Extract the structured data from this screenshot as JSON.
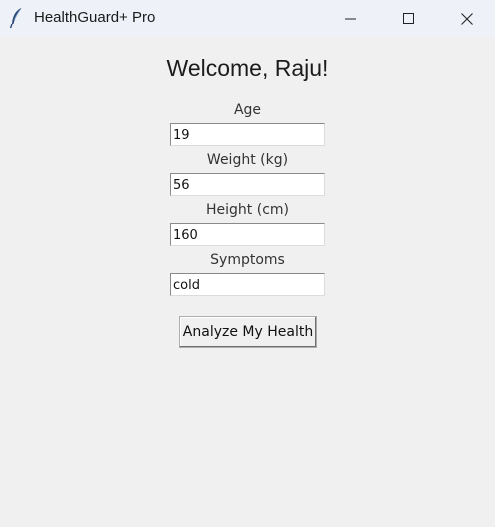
{
  "window": {
    "title": "HealthGuard+ Pro",
    "controls": {
      "minimize": "minimize-icon",
      "maximize": "maximize-icon",
      "close": "close-icon"
    }
  },
  "main": {
    "welcome": "Welcome, Raju!",
    "fields": {
      "age": {
        "label": "Age",
        "value": "19"
      },
      "weight": {
        "label": "Weight (kg)",
        "value": "56"
      },
      "height": {
        "label": "Height (cm)",
        "value": "160"
      },
      "symptoms": {
        "label": "Symptoms",
        "value": "cold"
      }
    },
    "analyze_label": "Analyze My Health"
  }
}
